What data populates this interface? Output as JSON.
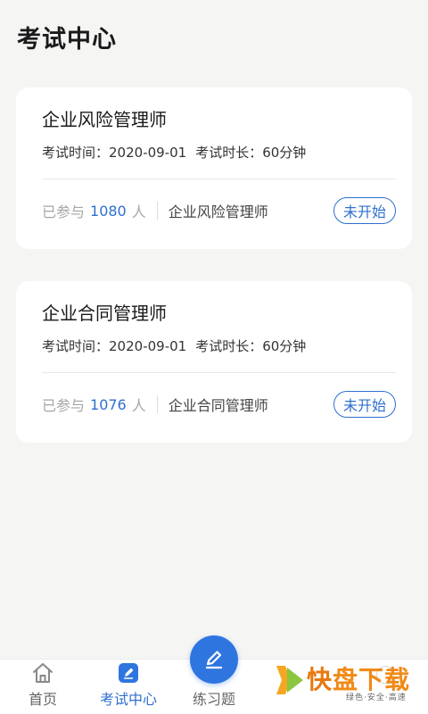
{
  "header": {
    "title": "考试中心"
  },
  "exams": [
    {
      "title": "企业风险管理师",
      "time_label": "考试时间：",
      "time_value": "2020-09-01",
      "duration_label": "考试时长：",
      "duration_value": "60分钟",
      "participants_prefix": "已参与",
      "participants_count": "1080",
      "participants_suffix": "人",
      "category": "企业风险管理师",
      "status": "未开始"
    },
    {
      "title": "企业合同管理师",
      "time_label": "考试时间：",
      "time_value": "2020-09-01",
      "duration_label": "考试时长：",
      "duration_value": "60分钟",
      "participants_prefix": "已参与",
      "participants_count": "1076",
      "participants_suffix": "人",
      "category": "企业合同管理师",
      "status": "未开始"
    }
  ],
  "tabbar": {
    "home_label": "首页",
    "exam_label": "考试中心",
    "practice_label": "练习题",
    "active_color": "#2f6fcf"
  },
  "watermark": {
    "brand_char1": "快",
    "brand_rest": "盘下载",
    "slogan": "绿色·安全·高速"
  },
  "colors": {
    "accent": "#2f6fcf",
    "background": "#f5f5f4",
    "card": "#ffffff"
  }
}
